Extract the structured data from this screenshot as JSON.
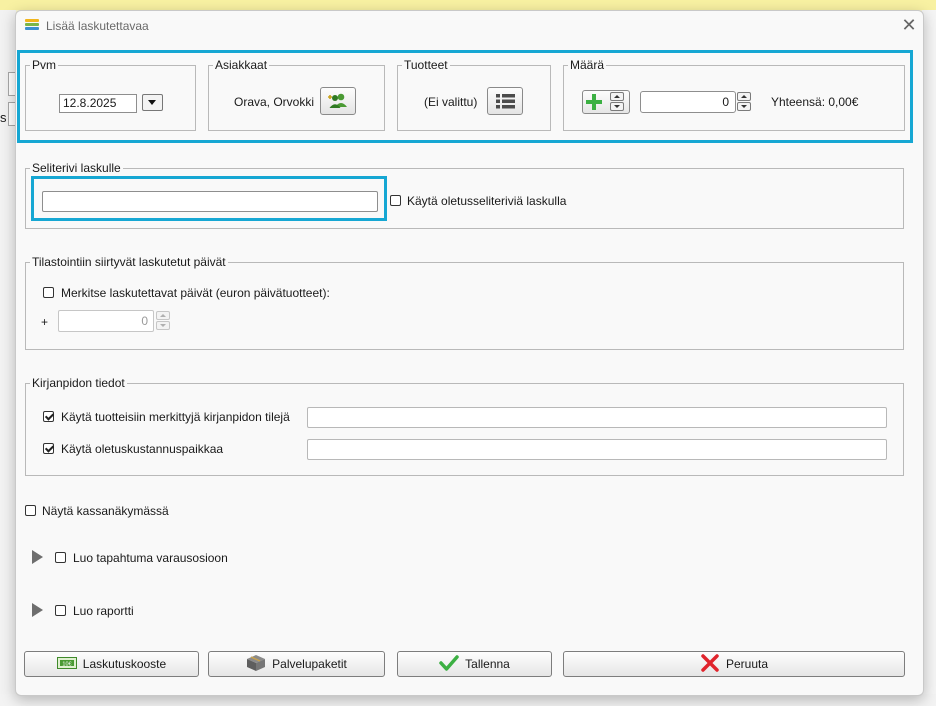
{
  "window": {
    "title": "Lisää laskutettavaa",
    "close_glyph": "✕"
  },
  "background": {
    "partial_letter": "s"
  },
  "header": {
    "pvm": {
      "legend": "Pvm",
      "date": "12.8.2025"
    },
    "asiakkaat": {
      "legend": "Asiakkaat",
      "value": "Orava, Orvokki",
      "icon": "add-customer-icon"
    },
    "tuotteet": {
      "legend": "Tuotteet",
      "value": "(Ei valittu)",
      "icon": "list-icon"
    },
    "maara": {
      "legend": "Määrä",
      "value": "0",
      "total": "Yhteensä: 0,00€",
      "icon": "plus-icon"
    }
  },
  "selite": {
    "legend": "Seliterivi laskulle",
    "value": "",
    "default_checkbox_label": "Käytä oletusseliteriviä laskulla",
    "default_checked": false
  },
  "tilastointi": {
    "legend": "Tilastointiin siirtyvät laskutetut päivät",
    "checkbox_label": "Merkitse laskutettavat päivät (euron päivätuotteet):",
    "checked": false,
    "plus_label": "+",
    "days_value": "0"
  },
  "kirjanpito": {
    "legend": "Kirjanpidon tiedot",
    "rows": [
      {
        "label": "Käytä tuotteisiin merkittyjä kirjanpidon tilejä",
        "checked": true,
        "value": ""
      },
      {
        "label": "Käytä oletuskustannuspaikkaa",
        "checked": true,
        "value": ""
      }
    ]
  },
  "options": {
    "kassa_label": "Näytä kassanäkymässä",
    "kassa_checked": false,
    "tapahtuma_label": "Luo tapahtuma varausosioon",
    "tapahtuma_checked": false,
    "raportti_label": "Luo raportti",
    "raportti_checked": false
  },
  "buttons": {
    "laskutuskooste": "Laskutuskooste",
    "palvelupaketit": "Palvelupaketit",
    "tallenna": "Tallenna",
    "peruuta": "Peruuta"
  },
  "colors": {
    "highlight": "#16a7d3",
    "confirm_green": "#3cb043",
    "cancel_red": "#e0242c",
    "icon_green": "#4a9a33"
  }
}
